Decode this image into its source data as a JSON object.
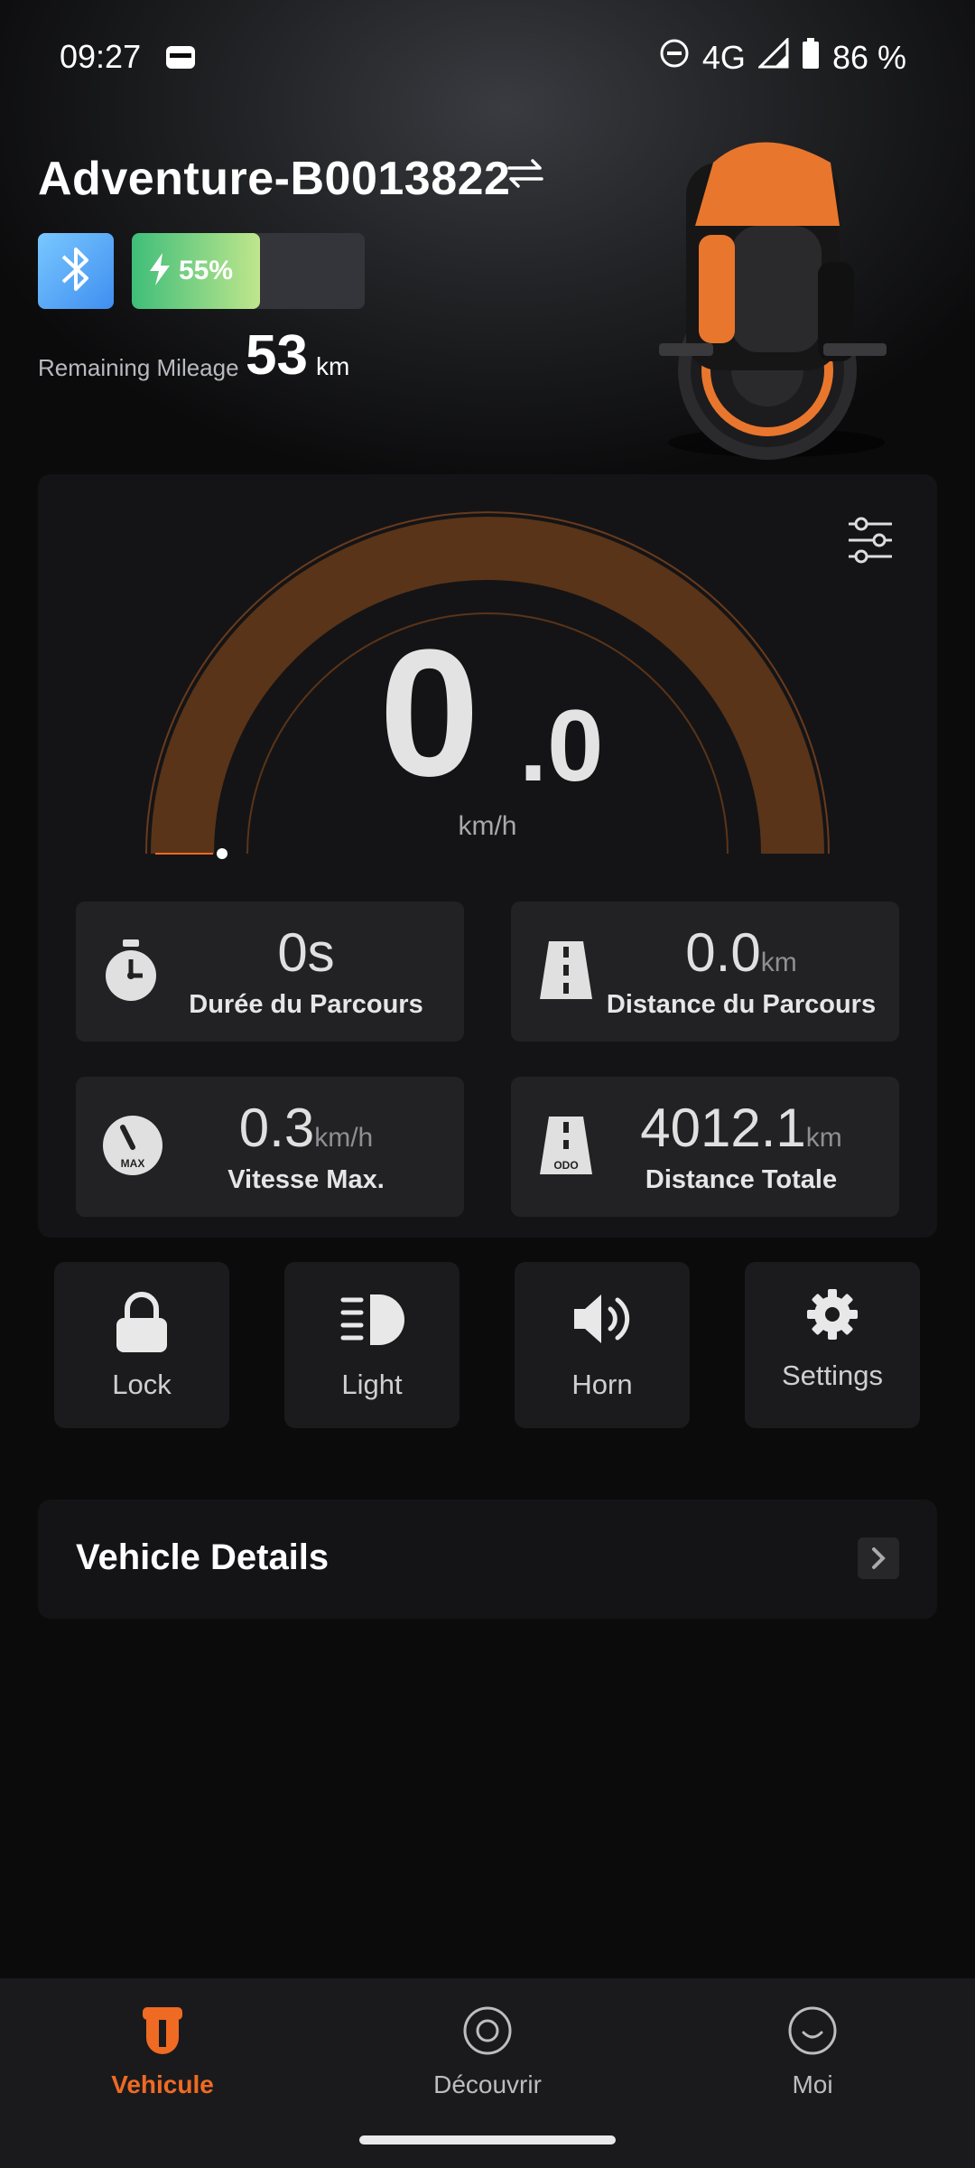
{
  "status_bar": {
    "time": "09:27",
    "network": "4G",
    "battery": "86 %"
  },
  "header": {
    "device_name": "Adventure-B0013822",
    "battery_percent": 55,
    "battery_label": "55%",
    "remaining_mileage_label": "Remaining Mileage",
    "remaining_mileage_value": "53",
    "remaining_mileage_unit": "km"
  },
  "dashboard": {
    "speed_integer": "0",
    "speed_decimal": ".0",
    "speed_unit": "km/h",
    "stats": [
      {
        "value": "0s",
        "unit": "",
        "label": "Durée du Parcours",
        "icon": "stopwatch-icon"
      },
      {
        "value": "0.0",
        "unit": "km",
        "label": "Distance du Parcours",
        "icon": "road-icon"
      },
      {
        "value": "0.3",
        "unit": "km/h",
        "label": "Vitesse Max.",
        "icon": "speedometer-max-icon"
      },
      {
        "value": "4012.1",
        "unit": "km",
        "label": "Distance Totale",
        "icon": "odometer-road-icon"
      }
    ]
  },
  "quick_actions": [
    {
      "label": "Lock",
      "icon": "lock-icon"
    },
    {
      "label": "Light",
      "icon": "headlight-icon"
    },
    {
      "label": "Horn",
      "icon": "speaker-icon"
    },
    {
      "label": "Settings",
      "icon": "gear-icon"
    }
  ],
  "details": {
    "title": "Vehicle Details"
  },
  "bottom_nav": [
    {
      "label": "Vehicule",
      "icon": "unicycle-icon",
      "active": true
    },
    {
      "label": "Découvrir",
      "icon": "discover-icon",
      "active": false
    },
    {
      "label": "Moi",
      "icon": "profile-smile-icon",
      "active": false
    }
  ],
  "colors": {
    "accent": "#ef6a23",
    "gauge_fill": "#5a3418",
    "bluetooth": "#4fa3f7",
    "battery": "#7fd48a"
  }
}
